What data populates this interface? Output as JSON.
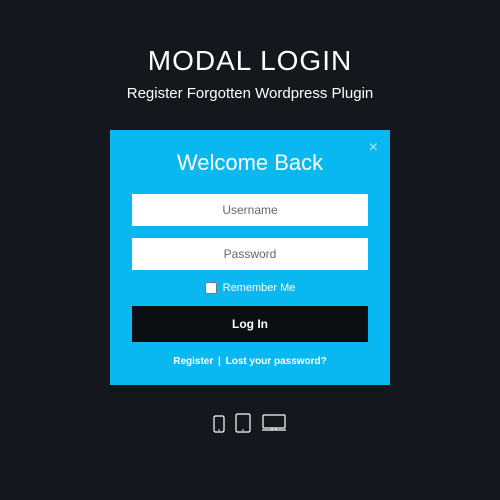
{
  "header": {
    "title": "MODAL LOGIN",
    "subtitle": "Register Forgotten Wordpress Plugin"
  },
  "modal": {
    "title": "Welcome Back",
    "username_placeholder": "Username",
    "password_placeholder": "Password",
    "remember_label": "Remember Me",
    "login_button": "Log In",
    "register_link": "Register",
    "separator": " | ",
    "lost_password_link": "Lost your password?"
  },
  "icons": {
    "phone": "phone-icon",
    "tablet": "tablet-icon",
    "desktop": "desktop-icon"
  }
}
